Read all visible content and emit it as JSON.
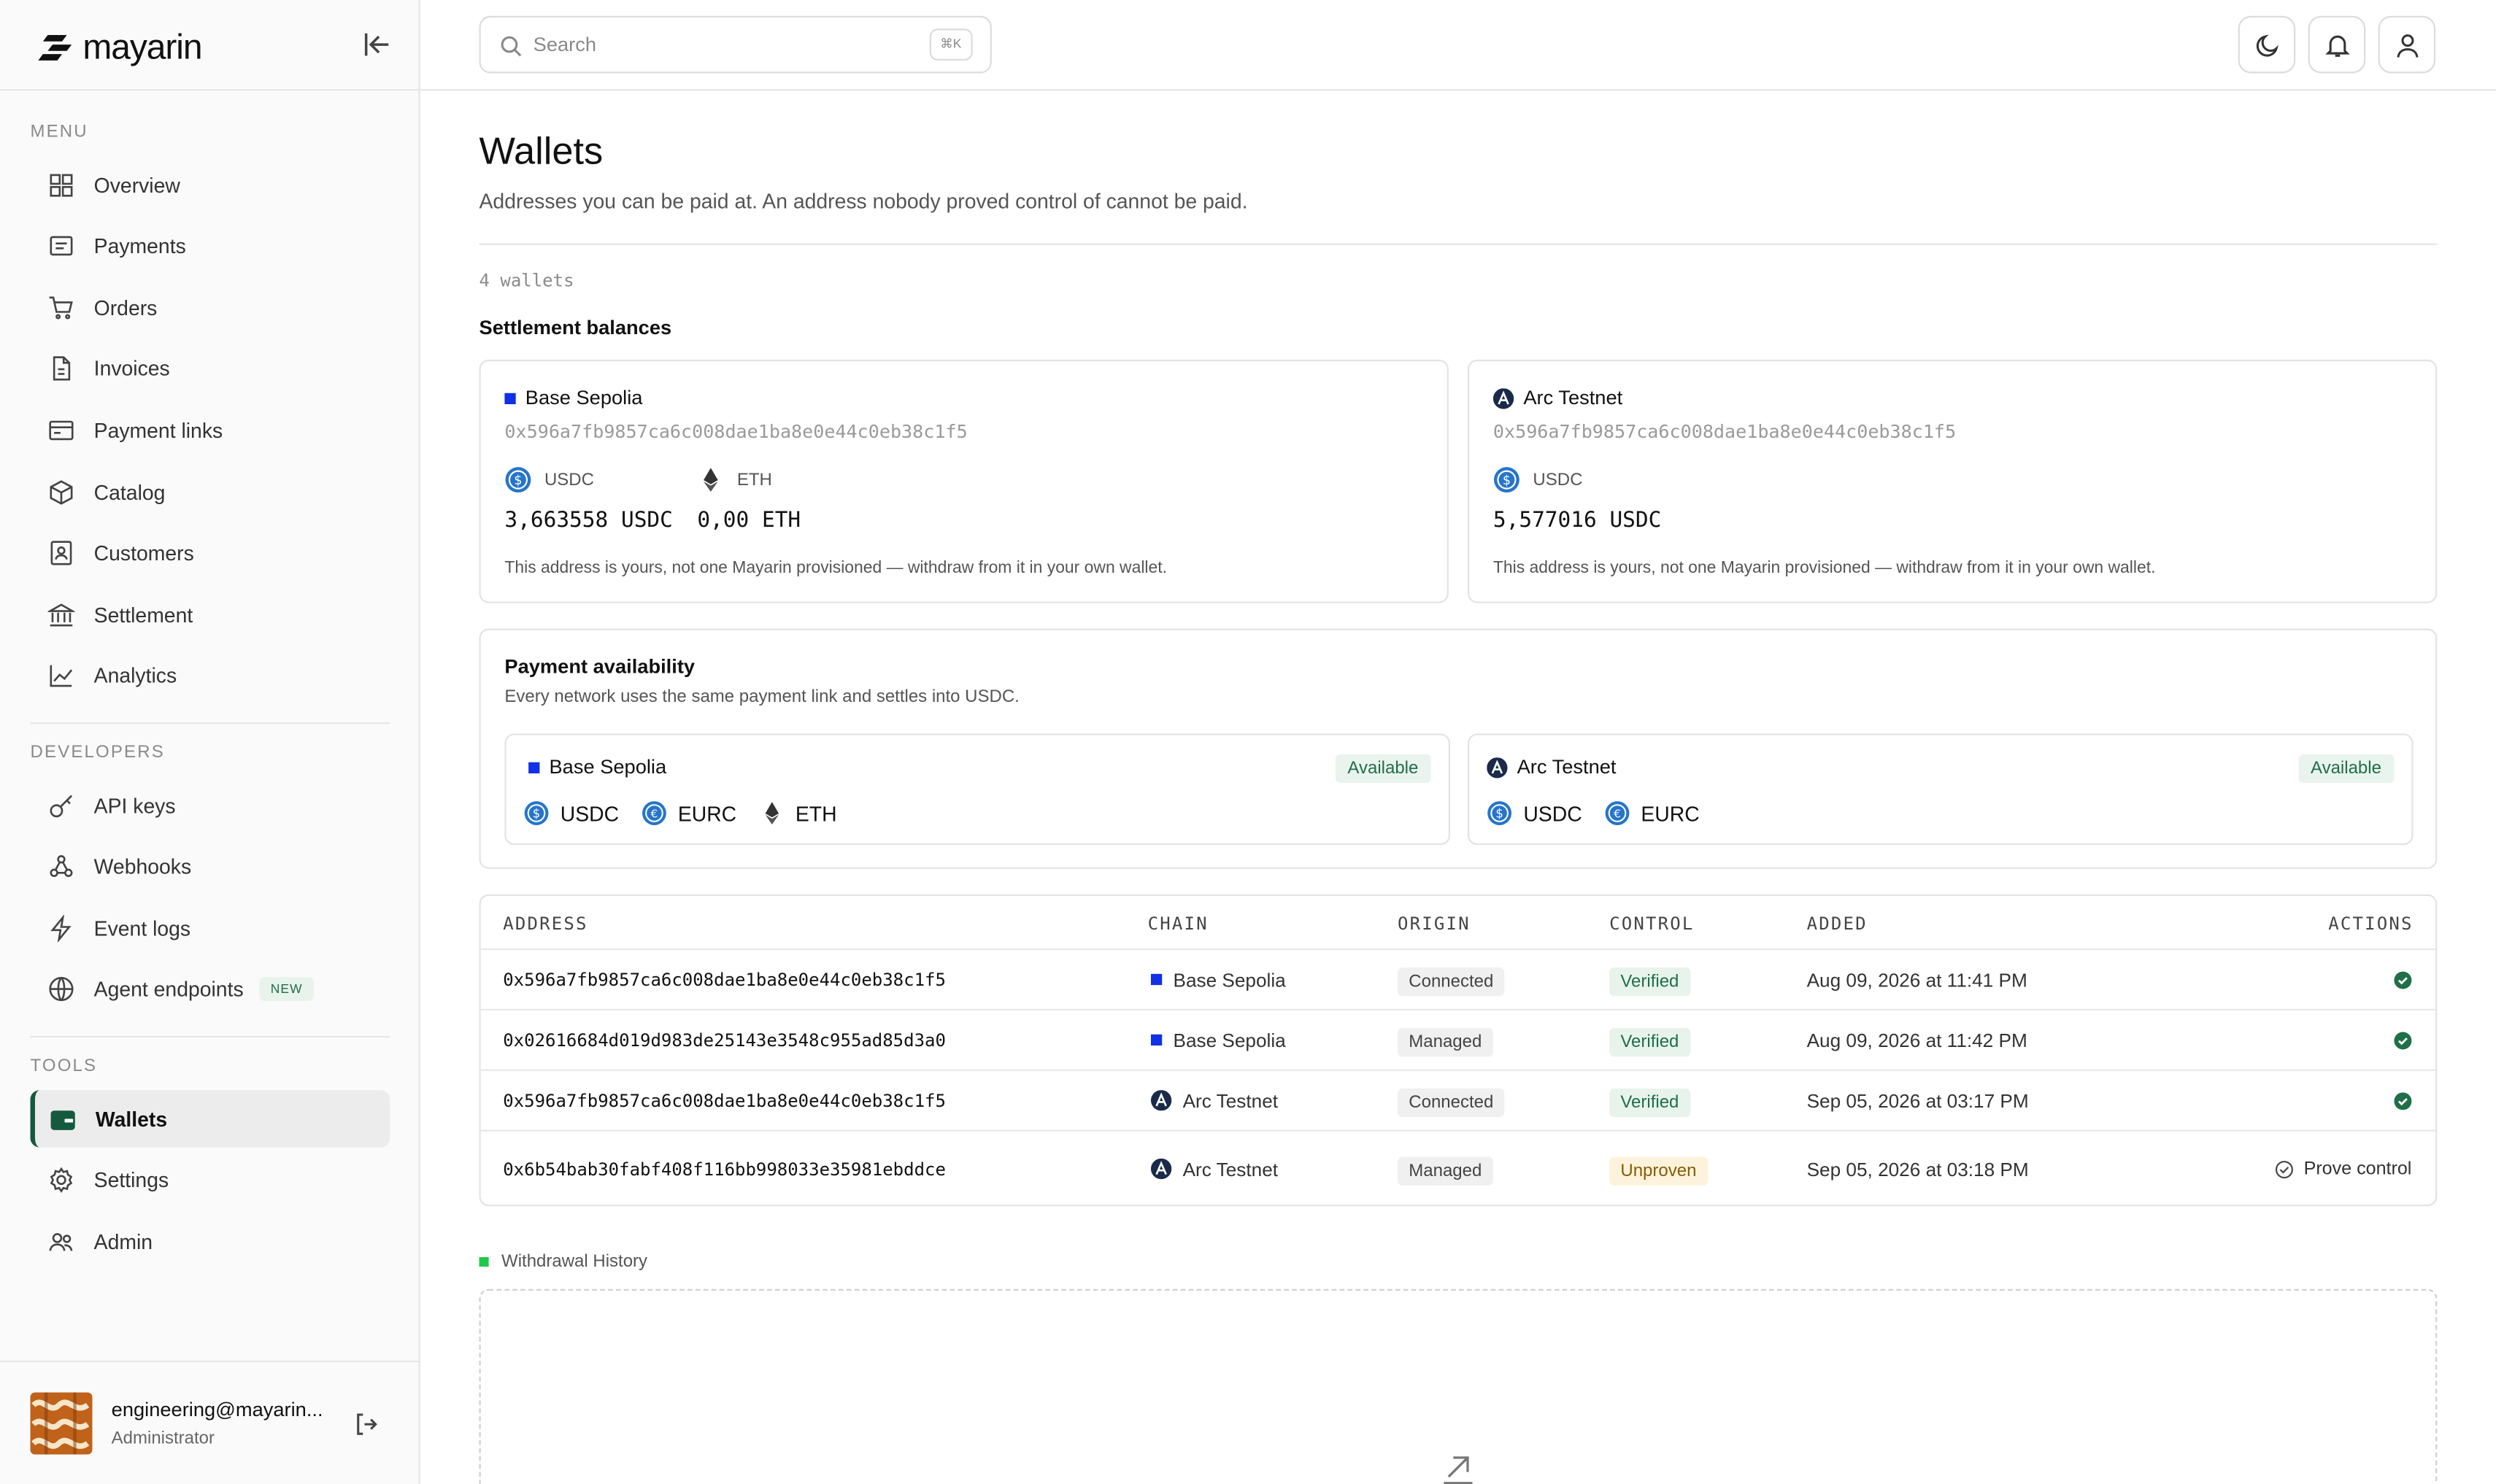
{
  "brand": {
    "name": "mayarin"
  },
  "sidebar": {
    "menu_label": "MENU",
    "menu": [
      {
        "label": "Overview",
        "icon": "grid-icon"
      },
      {
        "label": "Payments",
        "icon": "receipt-icon"
      },
      {
        "label": "Orders",
        "icon": "cart-icon"
      },
      {
        "label": "Invoices",
        "icon": "document-icon"
      },
      {
        "label": "Payment links",
        "icon": "link-card-icon"
      },
      {
        "label": "Catalog",
        "icon": "box-icon"
      },
      {
        "label": "Customers",
        "icon": "contacts-icon"
      },
      {
        "label": "Settlement",
        "icon": "bank-icon"
      },
      {
        "label": "Analytics",
        "icon": "chart-line-icon"
      }
    ],
    "developers_label": "DEVELOPERS",
    "developers": [
      {
        "label": "API keys",
        "icon": "key-icon"
      },
      {
        "label": "Webhooks",
        "icon": "webhook-icon"
      },
      {
        "label": "Event logs",
        "icon": "bolt-icon"
      },
      {
        "label": "Agent endpoints",
        "icon": "globe-icon",
        "badge": "NEW"
      }
    ],
    "tools_label": "TOOLS",
    "tools": [
      {
        "label": "Wallets",
        "icon": "wallet-icon",
        "active": true
      },
      {
        "label": "Settings",
        "icon": "gear-icon"
      },
      {
        "label": "Admin",
        "icon": "users-icon"
      }
    ],
    "user": {
      "email": "engineering@mayarin...",
      "role": "Administrator"
    }
  },
  "topbar": {
    "search_placeholder": "Search",
    "shortcut": "⌘K"
  },
  "page": {
    "title": "Wallets",
    "subtitle": "Addresses you can be paid at. An address nobody proved control of cannot be paid.",
    "count": "4 wallets",
    "settlement_title": "Settlement balances"
  },
  "balances": [
    {
      "network": "Base Sepolia",
      "address": "0x596a7fb9857ca6c008dae1ba8e0e44c0eb38c1f5",
      "tokens": [
        {
          "symbol": "USDC",
          "amount": "3,663558 USDC"
        },
        {
          "symbol": "ETH",
          "amount": "0,00 ETH"
        }
      ],
      "note": "This address is yours, not one Mayarin provisioned — withdraw from it in your own wallet."
    },
    {
      "network": "Arc Testnet",
      "address": "0x596a7fb9857ca6c008dae1ba8e0e44c0eb38c1f5",
      "tokens": [
        {
          "symbol": "USDC",
          "amount": "5,577016 USDC"
        }
      ],
      "note": "This address is yours, not one Mayarin provisioned — withdraw from it in your own wallet."
    }
  ],
  "availability": {
    "title": "Payment availability",
    "subtitle": "Every network uses the same payment link and settles into USDC.",
    "networks": [
      {
        "name": "Base Sepolia",
        "status": "Available",
        "tokens": [
          "USDC",
          "EURC",
          "ETH"
        ]
      },
      {
        "name": "Arc Testnet",
        "status": "Available",
        "tokens": [
          "USDC",
          "EURC"
        ]
      }
    ]
  },
  "table": {
    "headers": [
      "ADDRESS",
      "CHAIN",
      "ORIGIN",
      "CONTROL",
      "ADDED",
      "ACTIONS"
    ],
    "rows": [
      {
        "address": "0x596a7fb9857ca6c008dae1ba8e0e44c0eb38c1f5",
        "chain": "Base Sepolia",
        "origin": "Connected",
        "control": "Verified",
        "added": "Aug 09, 2026 at 11:41 PM",
        "action": ""
      },
      {
        "address": "0x02616684d019d983de25143e3548c955ad85d3a0",
        "chain": "Base Sepolia",
        "origin": "Managed",
        "control": "Verified",
        "added": "Aug 09, 2026 at 11:42 PM",
        "action": ""
      },
      {
        "address": "0x596a7fb9857ca6c008dae1ba8e0e44c0eb38c1f5",
        "chain": "Arc Testnet",
        "origin": "Connected",
        "control": "Verified",
        "added": "Sep 05, 2026 at 03:17 PM",
        "action": ""
      },
      {
        "address": "0x6b54bab30fabf408f116bb998033e35981ebddce",
        "chain": "Arc Testnet",
        "origin": "Managed",
        "control": "Unproven",
        "added": "Sep 05, 2026 at 03:18 PM",
        "action": "Prove control"
      }
    ]
  },
  "withdrawal": {
    "title": "Withdrawal History"
  },
  "colors": {
    "accent": "#145a3e",
    "base_blue": "#1230e6",
    "verified_green": "#1f6f48",
    "usdc_blue": "#2775ca"
  }
}
